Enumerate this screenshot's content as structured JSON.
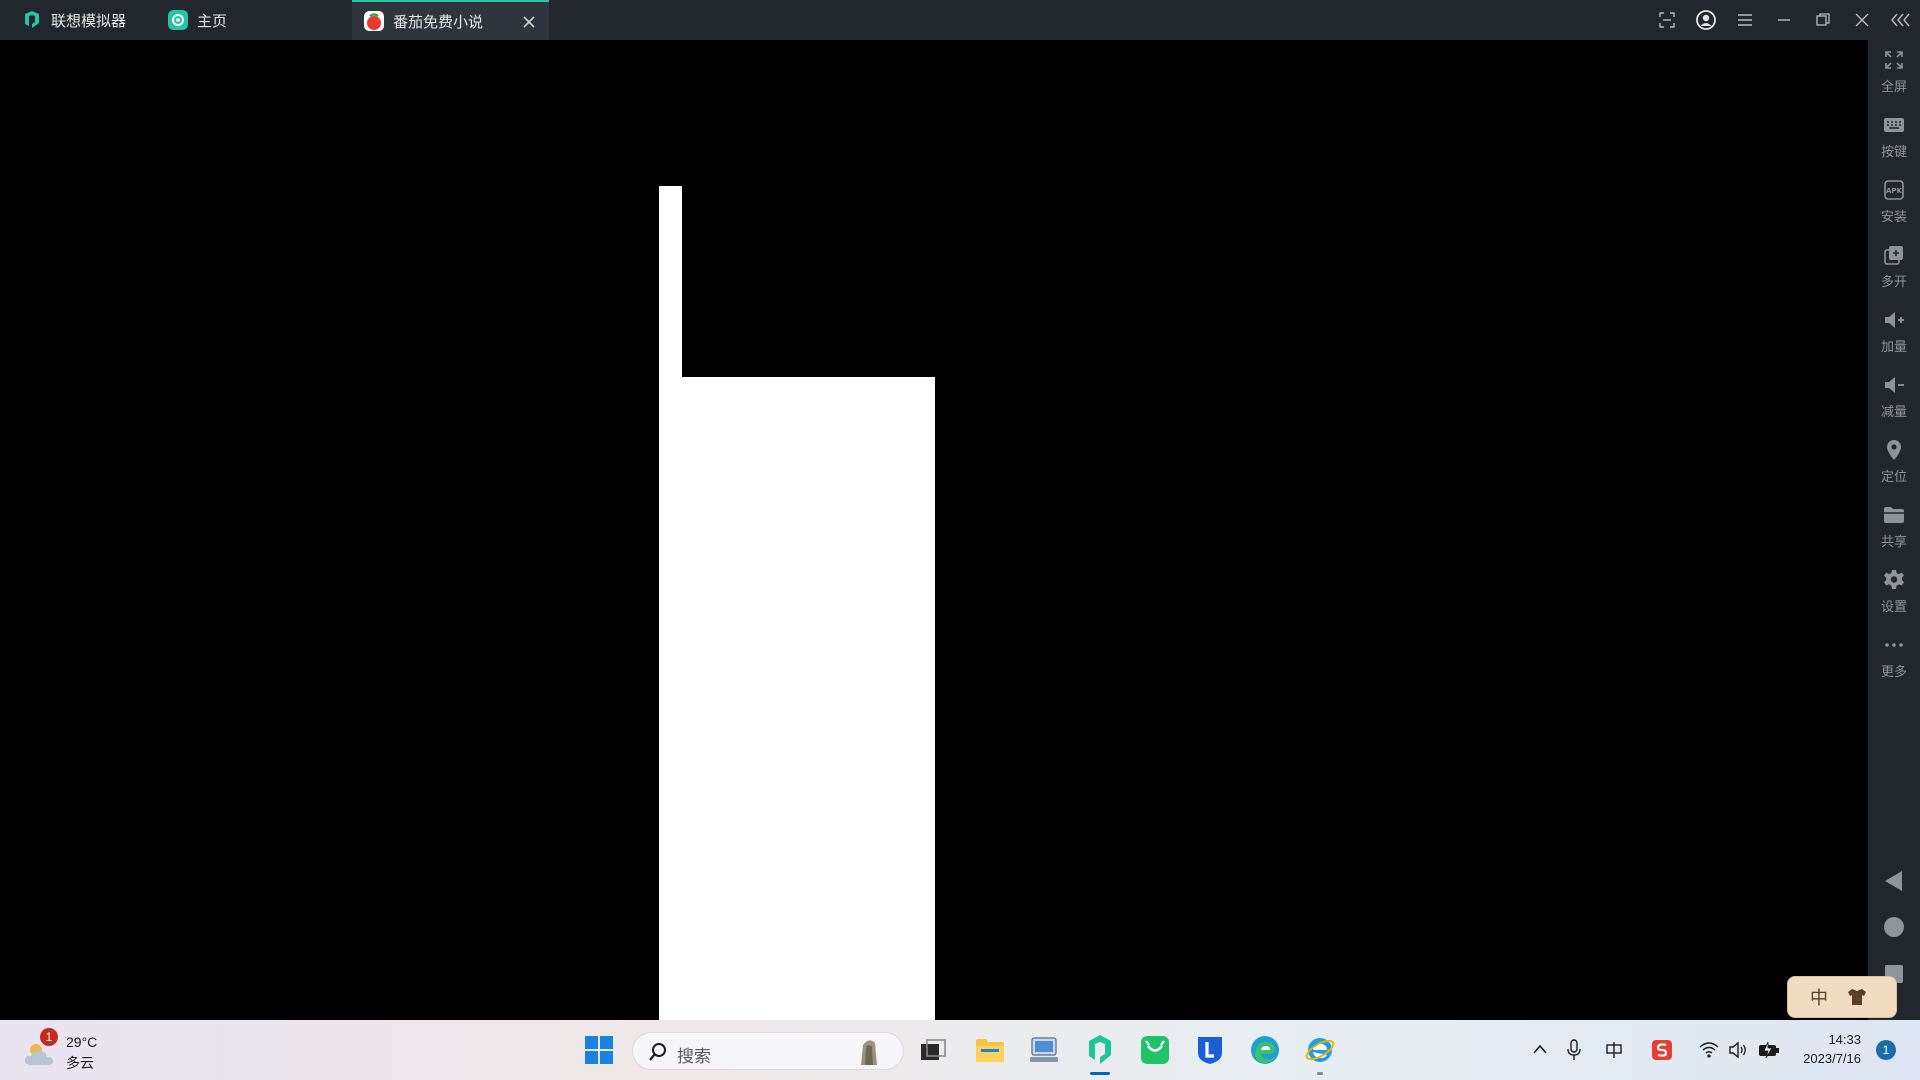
{
  "titlebar": {
    "app_name": "联想模拟器",
    "tabs": [
      {
        "label": "主页"
      },
      {
        "label": "番茄免费小说"
      }
    ]
  },
  "sidebar": {
    "items": [
      {
        "label": "全屏",
        "icon": "fullscreen-icon"
      },
      {
        "label": "按键",
        "icon": "keyboard-icon"
      },
      {
        "label": "安装",
        "icon": "apk-install-icon"
      },
      {
        "label": "多开",
        "icon": "multi-instance-icon"
      },
      {
        "label": "加量",
        "icon": "volume-up-icon"
      },
      {
        "label": "减量",
        "icon": "volume-down-icon"
      },
      {
        "label": "定位",
        "icon": "location-pin-icon"
      },
      {
        "label": "共享",
        "icon": "folder-icon"
      },
      {
        "label": "设置",
        "icon": "gear-icon"
      },
      {
        "label": "更多",
        "icon": "more-icon"
      }
    ],
    "android_nav": [
      "back-icon",
      "home-icon",
      "recents-icon"
    ]
  },
  "ime": {
    "lang": "中"
  },
  "taskbar": {
    "weather": {
      "temp": "29°C",
      "condition": "多云",
      "badge": "1"
    },
    "search_placeholder": "搜索",
    "clock_time": "14:33",
    "clock_date": "2023/7/16",
    "notification_count": "1"
  },
  "colors": {
    "accent": "#25c7a3",
    "titlebar_bg": "#22272e",
    "screen_bg": "#000000",
    "taskbar_accent": "#0067c0"
  }
}
